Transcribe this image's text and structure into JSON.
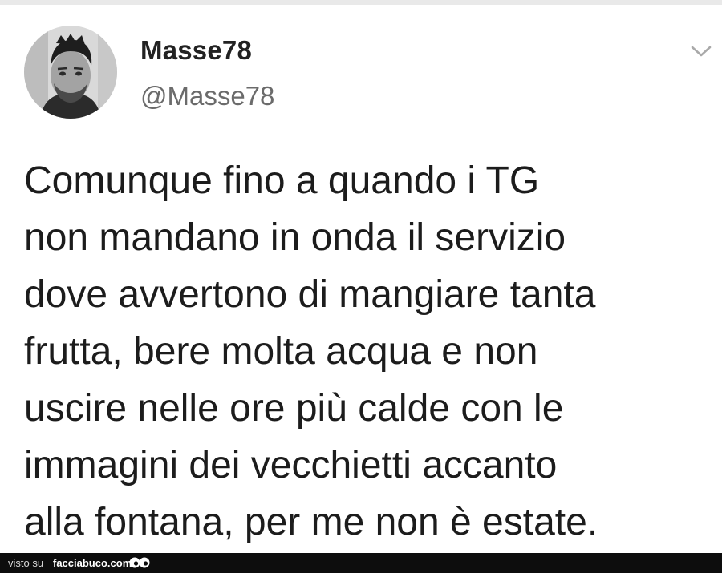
{
  "tweet": {
    "display_name": "Masse78",
    "handle": "@Masse78",
    "text": "Comunque fino a quando i TG\nnon mandano in onda il servizio\ndove avvertono di mangiare tanta\nfrutta, bere molta acqua e non\nuscire nelle ore più calde con le\nimmagini dei vecchietti accanto\nalla fontana, per me non è estate.",
    "avatar_icon": "profile-photo",
    "menu_icon": "chevron-down-icon"
  },
  "footer": {
    "visto_label": "visto su",
    "site_name": "facciabuco.com",
    "logo_icon": "eyes-icon"
  },
  "colors": {
    "text": "#1c1c1c",
    "handle": "#6b6b6b",
    "chevron": "#a9a9a9",
    "footer_bg": "#0d0d0d"
  }
}
